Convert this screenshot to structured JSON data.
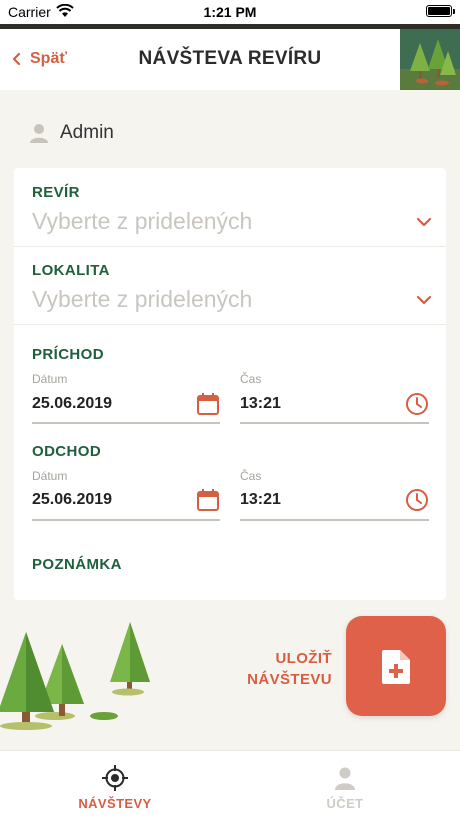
{
  "status_bar": {
    "carrier": "Carrier",
    "time": "1:21 PM"
  },
  "header": {
    "back_label": "Späť",
    "title": "NÁVŠTEVA REVÍRU"
  },
  "user": {
    "name": "Admin"
  },
  "form": {
    "revir": {
      "label": "REVÍR",
      "placeholder": "Vyberte z pridelených"
    },
    "lokalita": {
      "label": "LOKALITA",
      "placeholder": "Vyberte z pridelených"
    },
    "prichod": {
      "label": "PRÍCHOD",
      "date_label": "Dátum",
      "date_value": "25.06.2019",
      "time_label": "Čas",
      "time_value": "13:21"
    },
    "odchod": {
      "label": "ODCHOD",
      "date_label": "Dátum",
      "date_value": "25.06.2019",
      "time_label": "Čas",
      "time_value": "13:21"
    },
    "poznamka": {
      "label": "POZNÁMKA"
    }
  },
  "save": {
    "line1": "ULOŽIŤ",
    "line2": "NÁVŠTEVU"
  },
  "tabs": [
    {
      "label": "NÁVŠTEVY",
      "icon": "target-icon",
      "active": true
    },
    {
      "label": "ÚČET",
      "icon": "person-icon",
      "active": false
    }
  ],
  "colors": {
    "accent": "#d85e42",
    "green": "#1f5f3c",
    "background": "#f6f4ef"
  }
}
